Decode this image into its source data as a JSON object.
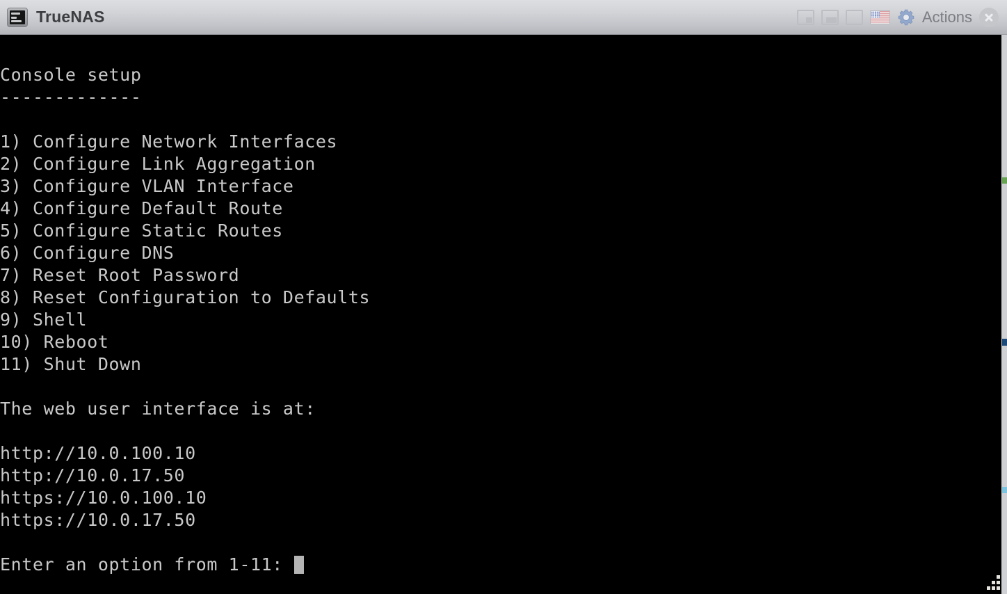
{
  "window": {
    "app_title": "TrueNAS",
    "app_icon": "terminal-monitor-icon",
    "titlebar_bg": "#d2d4d8",
    "terminal_bg": "#000000",
    "terminal_fg": "#c9c9c9"
  },
  "titlebar": {
    "fit_buttons": [
      {
        "name": "scale-to-fit-icon",
        "label": ""
      },
      {
        "name": "fit-to-window-icon",
        "label": ""
      },
      {
        "name": "fullscreen-icon",
        "label": ""
      }
    ],
    "keyboard_layout_icon": "us-flag-icon",
    "gear_icon": "gear-icon",
    "gear_color": "#8ba2c9",
    "actions_label": "Actions",
    "close_icon": "close-icon"
  },
  "console": {
    "heading": "Console setup",
    "heading_rule": "-------------",
    "menu": [
      "1) Configure Network Interfaces",
      "2) Configure Link Aggregation",
      "3) Configure VLAN Interface",
      "4) Configure Default Route",
      "5) Configure Static Routes",
      "6) Configure DNS",
      "7) Reset Root Password",
      "8) Reset Configuration to Defaults",
      "9) Shell",
      "10) Reboot",
      "11) Shut Down"
    ],
    "web_ui_label": "The web user interface is at:",
    "urls": [
      "http://10.0.100.10",
      "http://10.0.17.50",
      "https://10.0.100.10",
      "https://10.0.17.50"
    ],
    "prompt": "Enter an option from 1-11: ",
    "cursor": "block"
  }
}
